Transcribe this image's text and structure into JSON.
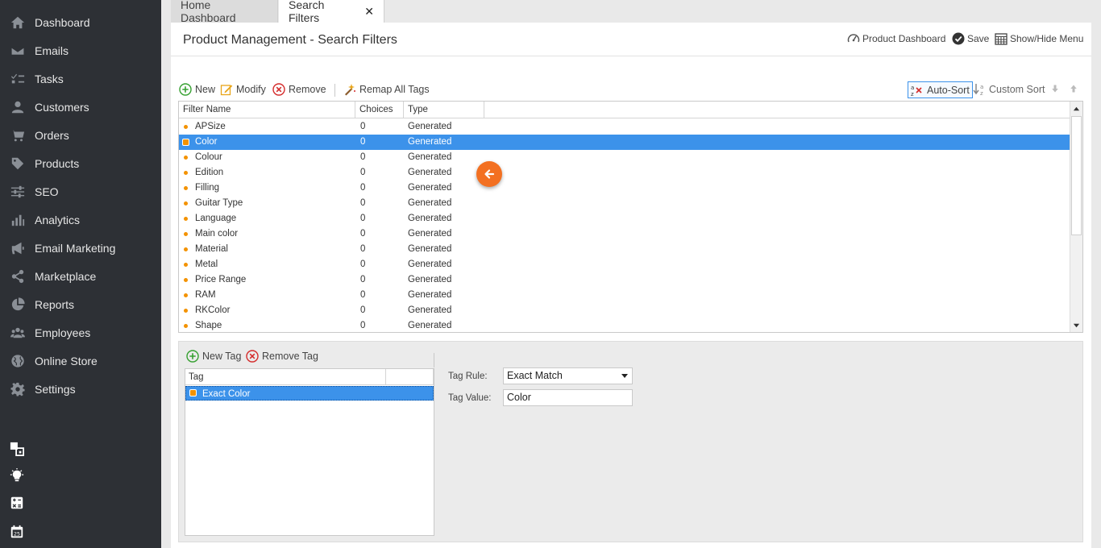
{
  "sidebar": {
    "items": [
      {
        "label": "Dashboard",
        "icon": "home-icon"
      },
      {
        "label": "Emails",
        "icon": "envelope-icon"
      },
      {
        "label": "Tasks",
        "icon": "tasks-icon"
      },
      {
        "label": "Customers",
        "icon": "user-icon"
      },
      {
        "label": "Orders",
        "icon": "cart-icon"
      },
      {
        "label": "Products",
        "icon": "tag-icon"
      },
      {
        "label": "SEO",
        "icon": "sliders-icon"
      },
      {
        "label": "Analytics",
        "icon": "bar-chart-icon"
      },
      {
        "label": "Email Marketing",
        "icon": "megaphone-icon"
      },
      {
        "label": "Marketplace",
        "icon": "share-icon"
      },
      {
        "label": "Reports",
        "icon": "pie-chart-icon"
      },
      {
        "label": "Employees",
        "icon": "users-icon"
      },
      {
        "label": "Online Store",
        "icon": "globe-icon"
      },
      {
        "label": "Settings",
        "icon": "gear-icon"
      }
    ],
    "utilities": [
      "layers-icon",
      "lightbulb-icon",
      "calculator-icon",
      "calendar-icon"
    ],
    "calendar_day": "25"
  },
  "tabs": [
    {
      "label": "Home Dashboard",
      "active": false
    },
    {
      "label": "Search Filters",
      "active": true,
      "close": "✕"
    }
  ],
  "header": {
    "title": "Product Management - Search Filters",
    "actions": {
      "dashboard": "Product Dashboard",
      "save": "Save",
      "show_hide": "Show/Hide Menu"
    }
  },
  "toolbar": {
    "new": "New",
    "modify": "Modify",
    "remove": "Remove",
    "remap": "Remap All Tags",
    "auto_sort": "Auto-Sort",
    "custom_sort": "Custom Sort"
  },
  "grid": {
    "columns": [
      "Filter Name",
      "Choices",
      "Type"
    ],
    "rows": [
      {
        "name": "APSize",
        "choices": "0",
        "type": "Generated"
      },
      {
        "name": "Color",
        "choices": "0",
        "type": "Generated",
        "selected": true
      },
      {
        "name": "Colour",
        "choices": "0",
        "type": "Generated"
      },
      {
        "name": "Edition",
        "choices": "0",
        "type": "Generated"
      },
      {
        "name": "Filling",
        "choices": "0",
        "type": "Generated"
      },
      {
        "name": "Guitar Type",
        "choices": "0",
        "type": "Generated"
      },
      {
        "name": "Language",
        "choices": "0",
        "type": "Generated"
      },
      {
        "name": "Main color",
        "choices": "0",
        "type": "Generated"
      },
      {
        "name": "Material",
        "choices": "0",
        "type": "Generated"
      },
      {
        "name": "Metal",
        "choices": "0",
        "type": "Generated"
      },
      {
        "name": "Price Range",
        "choices": "0",
        "type": "Generated"
      },
      {
        "name": "RAM",
        "choices": "0",
        "type": "Generated"
      },
      {
        "name": "RKColor",
        "choices": "0",
        "type": "Generated"
      },
      {
        "name": "Shape",
        "choices": "0",
        "type": "Generated"
      }
    ]
  },
  "tags": {
    "new": "New Tag",
    "remove": "Remove Tag",
    "column": "Tag",
    "items": [
      {
        "label": "Exact Color",
        "selected": true
      }
    ]
  },
  "tag_detail": {
    "rule_label": "Tag Rule:",
    "rule_value": "Exact Match",
    "value_label": "Tag Value:",
    "value": "Color"
  },
  "colors": {
    "sidebar_bg": "#2d3035",
    "selection": "#3c92ea",
    "accent_orange": "#f37021",
    "bullet": "#f39200"
  }
}
